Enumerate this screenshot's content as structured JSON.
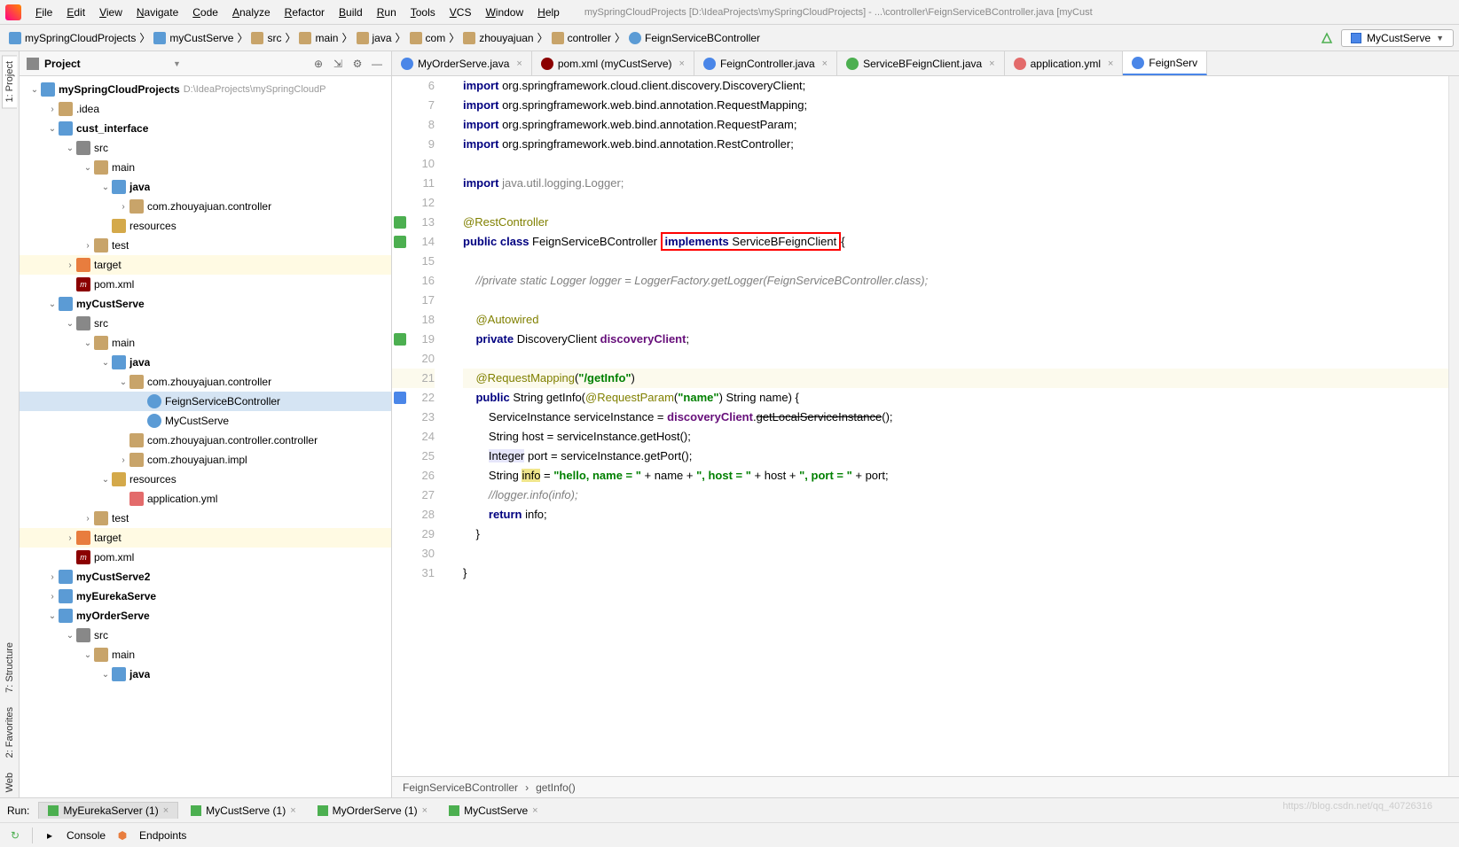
{
  "window_title": "mySpringCloudProjects [D:\\IdeaProjects\\mySpringCloudProjects] - ...\\controller\\FeignServiceBController.java [myCust",
  "menu": [
    "File",
    "Edit",
    "View",
    "Navigate",
    "Code",
    "Analyze",
    "Refactor",
    "Build",
    "Run",
    "Tools",
    "VCS",
    "Window",
    "Help"
  ],
  "breadcrumb": [
    {
      "icon": "module",
      "label": "mySpringCloudProjects"
    },
    {
      "icon": "module",
      "label": "myCustServe"
    },
    {
      "icon": "folder",
      "label": "src"
    },
    {
      "icon": "folder",
      "label": "main"
    },
    {
      "icon": "folder",
      "label": "java"
    },
    {
      "icon": "folder",
      "label": "com"
    },
    {
      "icon": "folder",
      "label": "zhouyajuan"
    },
    {
      "icon": "folder",
      "label": "controller"
    },
    {
      "icon": "java",
      "label": "FeignServiceBController"
    }
  ],
  "run_config": "MyCustServe",
  "project_panel_title": "Project",
  "tree": [
    {
      "d": 0,
      "a": "v",
      "ic": "module",
      "name": "mySpringCloudProjects",
      "path": "D:\\IdeaProjects\\mySpringCloudP"
    },
    {
      "d": 1,
      "a": ">",
      "ic": "folder",
      "name": ".idea"
    },
    {
      "d": 1,
      "a": "v",
      "ic": "module",
      "name": "cust_interface"
    },
    {
      "d": 2,
      "a": "v",
      "ic": "src",
      "name": "src"
    },
    {
      "d": 3,
      "a": "v",
      "ic": "folder",
      "name": "main"
    },
    {
      "d": 4,
      "a": "v",
      "ic": "module",
      "name": "java"
    },
    {
      "d": 5,
      "a": ">",
      "ic": "folder",
      "name": "com.zhouyajuan.controller"
    },
    {
      "d": 4,
      "a": "",
      "ic": "res",
      "name": "resources"
    },
    {
      "d": 3,
      "a": ">",
      "ic": "folder",
      "name": "test"
    },
    {
      "d": 2,
      "a": ">",
      "ic": "target",
      "name": "target",
      "hl": 1
    },
    {
      "d": 2,
      "a": "",
      "ic": "maven",
      "name": "pom.xml"
    },
    {
      "d": 1,
      "a": "v",
      "ic": "module",
      "name": "myCustServe"
    },
    {
      "d": 2,
      "a": "v",
      "ic": "src",
      "name": "src"
    },
    {
      "d": 3,
      "a": "v",
      "ic": "folder",
      "name": "main"
    },
    {
      "d": 4,
      "a": "v",
      "ic": "module",
      "name": "java"
    },
    {
      "d": 5,
      "a": "v",
      "ic": "folder",
      "name": "com.zhouyajuan.controller"
    },
    {
      "d": 6,
      "a": "",
      "ic": "java-file",
      "name": "FeignServiceBController",
      "sel": 1
    },
    {
      "d": 6,
      "a": "",
      "ic": "java-file",
      "name": "MyCustServe"
    },
    {
      "d": 5,
      "a": "",
      "ic": "folder",
      "name": "com.zhouyajuan.controller.controller"
    },
    {
      "d": 5,
      "a": ">",
      "ic": "folder",
      "name": "com.zhouyajuan.impl"
    },
    {
      "d": 4,
      "a": "v",
      "ic": "res",
      "name": "resources"
    },
    {
      "d": 5,
      "a": "",
      "ic": "yml",
      "name": "application.yml"
    },
    {
      "d": 3,
      "a": ">",
      "ic": "folder",
      "name": "test"
    },
    {
      "d": 2,
      "a": ">",
      "ic": "target",
      "name": "target",
      "hl": 1
    },
    {
      "d": 2,
      "a": "",
      "ic": "maven",
      "name": "pom.xml"
    },
    {
      "d": 1,
      "a": ">",
      "ic": "module",
      "name": "myCustServe2"
    },
    {
      "d": 1,
      "a": ">",
      "ic": "module",
      "name": "myEurekaServe"
    },
    {
      "d": 1,
      "a": "v",
      "ic": "module",
      "name": "myOrderServe"
    },
    {
      "d": 2,
      "a": "v",
      "ic": "src",
      "name": "src"
    },
    {
      "d": 3,
      "a": "v",
      "ic": "folder",
      "name": "main"
    },
    {
      "d": 4,
      "a": "v",
      "ic": "module",
      "name": "java"
    }
  ],
  "editor_tabs": [
    {
      "ic": "c-blue",
      "label": "MyOrderServe.java"
    },
    {
      "ic": "c-maven",
      "label": "pom.xml (myCustServe)"
    },
    {
      "ic": "c-blue",
      "label": "FeignController.java"
    },
    {
      "ic": "c-green",
      "label": "ServiceBFeignClient.java"
    },
    {
      "ic": "c-yml",
      "label": "application.yml"
    },
    {
      "ic": "c-blue",
      "label": "FeignServ",
      "active": 1
    }
  ],
  "code_breadcrumb": [
    "FeignServiceBController",
    "getInfo()"
  ],
  "vtab_left": [
    "1: Project",
    "7: Structure",
    "2: Favorites",
    "Web"
  ],
  "run": {
    "label": "Run:",
    "tabs": [
      {
        "label": "MyEurekaServer (1)",
        "active": 1
      },
      {
        "label": "MyCustServe (1)"
      },
      {
        "label": "MyOrderServe (1)"
      },
      {
        "label": "MyCustServe"
      }
    ],
    "sub": [
      "Console",
      "Endpoints"
    ]
  },
  "code": {
    "start": 6,
    "lines": [
      {
        "n": 6,
        "h": "<span class='kw'>import</span> org.springframework.cloud.client.discovery.DiscoveryClient;"
      },
      {
        "n": 7,
        "h": "<span class='kw'>import</span> org.springframework.web.bind.annotation.<span class='cls'>RequestMapping</span>;"
      },
      {
        "n": 8,
        "h": "<span class='kw'>import</span> org.springframework.web.bind.annotation.<span class='cls'>RequestParam</span>;"
      },
      {
        "n": 9,
        "h": "<span class='kw'>import</span> org.springframework.web.bind.annotation.<span class='cls'>RestController</span>;"
      },
      {
        "n": 10,
        "h": ""
      },
      {
        "n": 11,
        "h": "<span class='kw'>import</span> <span class='pkg-d'>java.util.logging.Logger;</span>"
      },
      {
        "n": 12,
        "h": ""
      },
      {
        "n": 13,
        "h": "<span class='ann'>@RestController</span>",
        "mark": "impl"
      },
      {
        "n": 14,
        "h": "<span class='kw'>public class</span> FeignServiceBController <span class='redbox'><span class='kw'>implements</span> ServiceBFeignClient</span>{",
        "mark": "impl"
      },
      {
        "n": 15,
        "h": ""
      },
      {
        "n": 16,
        "h": "    <span class='cmt'>//private static Logger logger = LoggerFactory.getLogger(FeignServiceBController.class);</span>"
      },
      {
        "n": 17,
        "h": ""
      },
      {
        "n": 18,
        "h": "    <span class='ann'>@Autowired</span>"
      },
      {
        "n": 19,
        "h": "    <span class='kw'>private</span> DiscoveryClient <span class='fld'>discoveryClient</span>;",
        "mark": "impl"
      },
      {
        "n": 20,
        "h": ""
      },
      {
        "n": 21,
        "h": "    <span class='ann'>@RequestMapping</span>(<span class='str'>\"/getInfo\"</span>)",
        "hl": 1
      },
      {
        "n": 22,
        "h": "    <span class='kw'>public</span> String getInfo(<span class='ann'>@RequestParam</span>(<span class='str'>\"name\"</span>) String name) {",
        "mark": "over"
      },
      {
        "n": 23,
        "h": "        ServiceInstance serviceInstance = <span class='fld'>discoveryClient</span>.<span class='strike'>getLocalServiceInstance</span>();"
      },
      {
        "n": 24,
        "h": "        String host = serviceInstance.getHost();"
      },
      {
        "n": 25,
        "h": "        <span class='hlbox'>Integer</span> port = serviceInstance.getPort();"
      },
      {
        "n": 26,
        "h": "        String <span class='hlyel'>info</span> = <span class='str'>\"hello, name = \"</span> + name + <span class='str'>\", host = \"</span> + host + <span class='str'>\", port = \"</span> + port;"
      },
      {
        "n": 27,
        "h": "        <span class='cmt'>//logger.info(info);</span>"
      },
      {
        "n": 28,
        "h": "        <span class='kw'>return</span> info;"
      },
      {
        "n": 29,
        "h": "    }"
      },
      {
        "n": 30,
        "h": ""
      },
      {
        "n": 31,
        "h": "}"
      }
    ]
  }
}
